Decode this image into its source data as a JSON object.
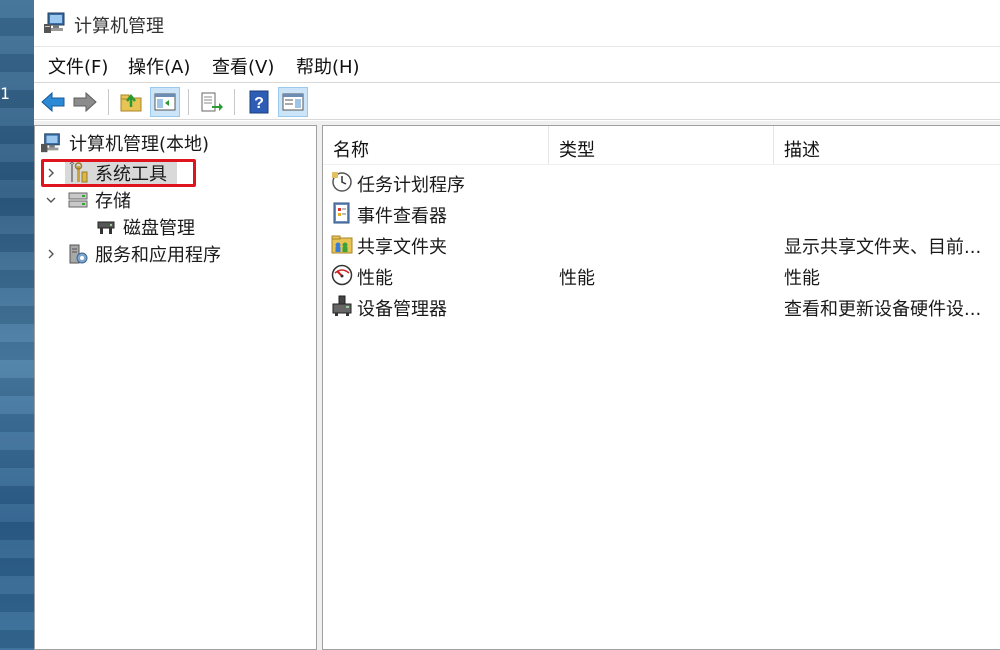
{
  "window": {
    "title": "计算机管理"
  },
  "desktop": {
    "edge_glyph": "1"
  },
  "menu": {
    "items": [
      "文件(F)",
      "操作(A)",
      "查看(V)",
      "帮助(H)"
    ]
  },
  "toolbar": {
    "buttons": [
      "back-arrow-icon",
      "forward-arrow-icon",
      "up-folder-icon",
      "show-hide-tree-icon",
      "export-list-icon",
      "help-icon",
      "show-hide-action-pane-icon"
    ]
  },
  "tree": {
    "root": "计算机管理(本地)",
    "items": [
      {
        "label": "系统工具",
        "expanded": false,
        "selected": true
      },
      {
        "label": "存储",
        "expanded": true,
        "children": [
          {
            "label": "磁盘管理"
          }
        ]
      },
      {
        "label": "服务和应用程序",
        "expanded": false
      }
    ]
  },
  "list": {
    "columns": [
      "名称",
      "类型",
      "描述"
    ],
    "rows": [
      {
        "name": "任务计划程序",
        "type": "",
        "desc": "",
        "icon": "clock-icon"
      },
      {
        "name": "事件查看器",
        "type": "",
        "desc": "",
        "icon": "event-viewer-icon"
      },
      {
        "name": "共享文件夹",
        "type": "",
        "desc": "显示共享文件夹、目前...",
        "icon": "shared-folder-icon"
      },
      {
        "name": "性能",
        "type": "性能",
        "desc": "性能",
        "icon": "performance-icon"
      },
      {
        "name": "设备管理器",
        "type": "",
        "desc": "查看和更新设备硬件设...",
        "icon": "device-manager-icon"
      }
    ]
  },
  "colors": {
    "selection_highlight": "#e0141e",
    "selected_item_bg": "#d9d9d9",
    "pressed_button_bg": "#cce4f7"
  }
}
